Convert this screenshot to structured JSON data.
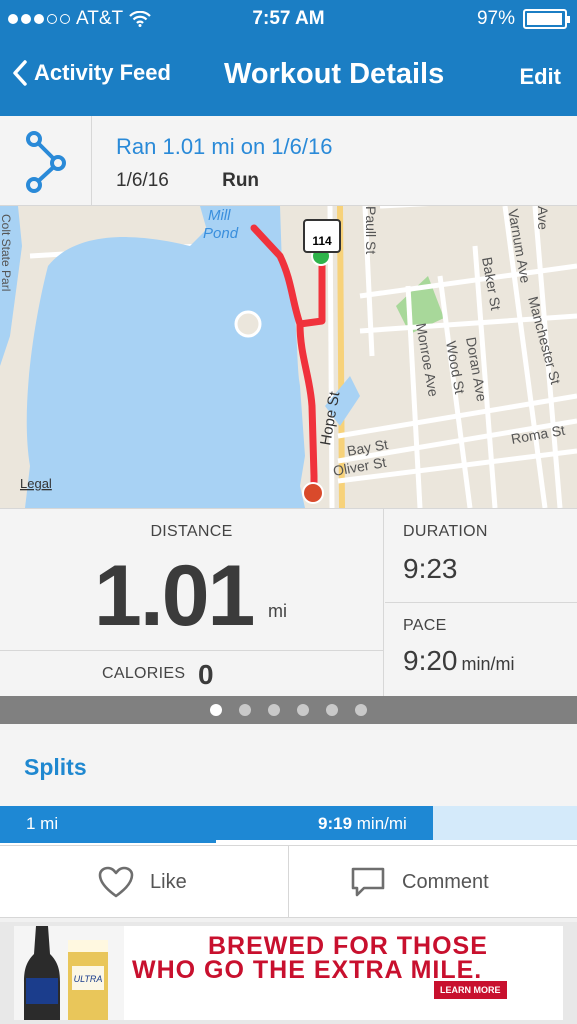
{
  "status_bar": {
    "carrier": "AT&T",
    "time": "7:57 AM",
    "battery": "97%",
    "battery_level": 0.97,
    "signal_bars_filled": 3,
    "signal_bars_total": 5
  },
  "nav": {
    "back_label": "Activity Feed",
    "title": "Workout Details",
    "edit_label": "Edit"
  },
  "activity": {
    "title": "Ran 1.01 mi on 1/6/16",
    "date": "1/6/16",
    "type": "Run"
  },
  "map": {
    "legal_label": "Legal",
    "labels": {
      "mill": "Mill",
      "pond": "Pond",
      "route_shield": "114",
      "hope_st": "Hope St",
      "bay_st": "Bay St",
      "oliver_st": "Oliver St",
      "roma_st": "Roma St",
      "monroe_ave": "Monroe Ave",
      "wood_st": "Wood St",
      "doran_ave": "Doran Ave",
      "baker_st": "Baker St",
      "varnum_ave": "Varnum Ave",
      "manchester_st": "Manchester St",
      "paull_st": "Paull St",
      "ave": "Ave",
      "colt_state_park": "Colt State Parl"
    },
    "route_color": "#f0323c",
    "start_color": "#2eb34a",
    "end_color": "#d94a2b"
  },
  "stats": {
    "distance_label": "DISTANCE",
    "distance_value": "1.01",
    "distance_unit": "mi",
    "duration_label": "DURATION",
    "duration_value": "9:23",
    "pace_label": "PACE",
    "pace_value": "9:20",
    "pace_unit": "min/mi",
    "calories_label": "CALORIES",
    "calories_value": "0"
  },
  "pager": {
    "count": 6,
    "active_index": 0
  },
  "splits": {
    "title": "Splits",
    "rows": [
      {
        "label": "1 mi",
        "pace": "9:19",
        "pace_unit": "min/mi",
        "bar_fraction": 0.75
      }
    ]
  },
  "actions": {
    "like_label": "Like",
    "comment_label": "Comment"
  },
  "ad": {
    "line1": "BREWED FOR THOSE",
    "line2": "WHO GO THE EXTRA MILE.",
    "button": "LEARN MORE"
  },
  "colors": {
    "brand_blue": "#1b7ec4",
    "link_blue": "#2a8ad8",
    "split_bar": "#1e88d4",
    "ad_red": "#c8102e"
  }
}
